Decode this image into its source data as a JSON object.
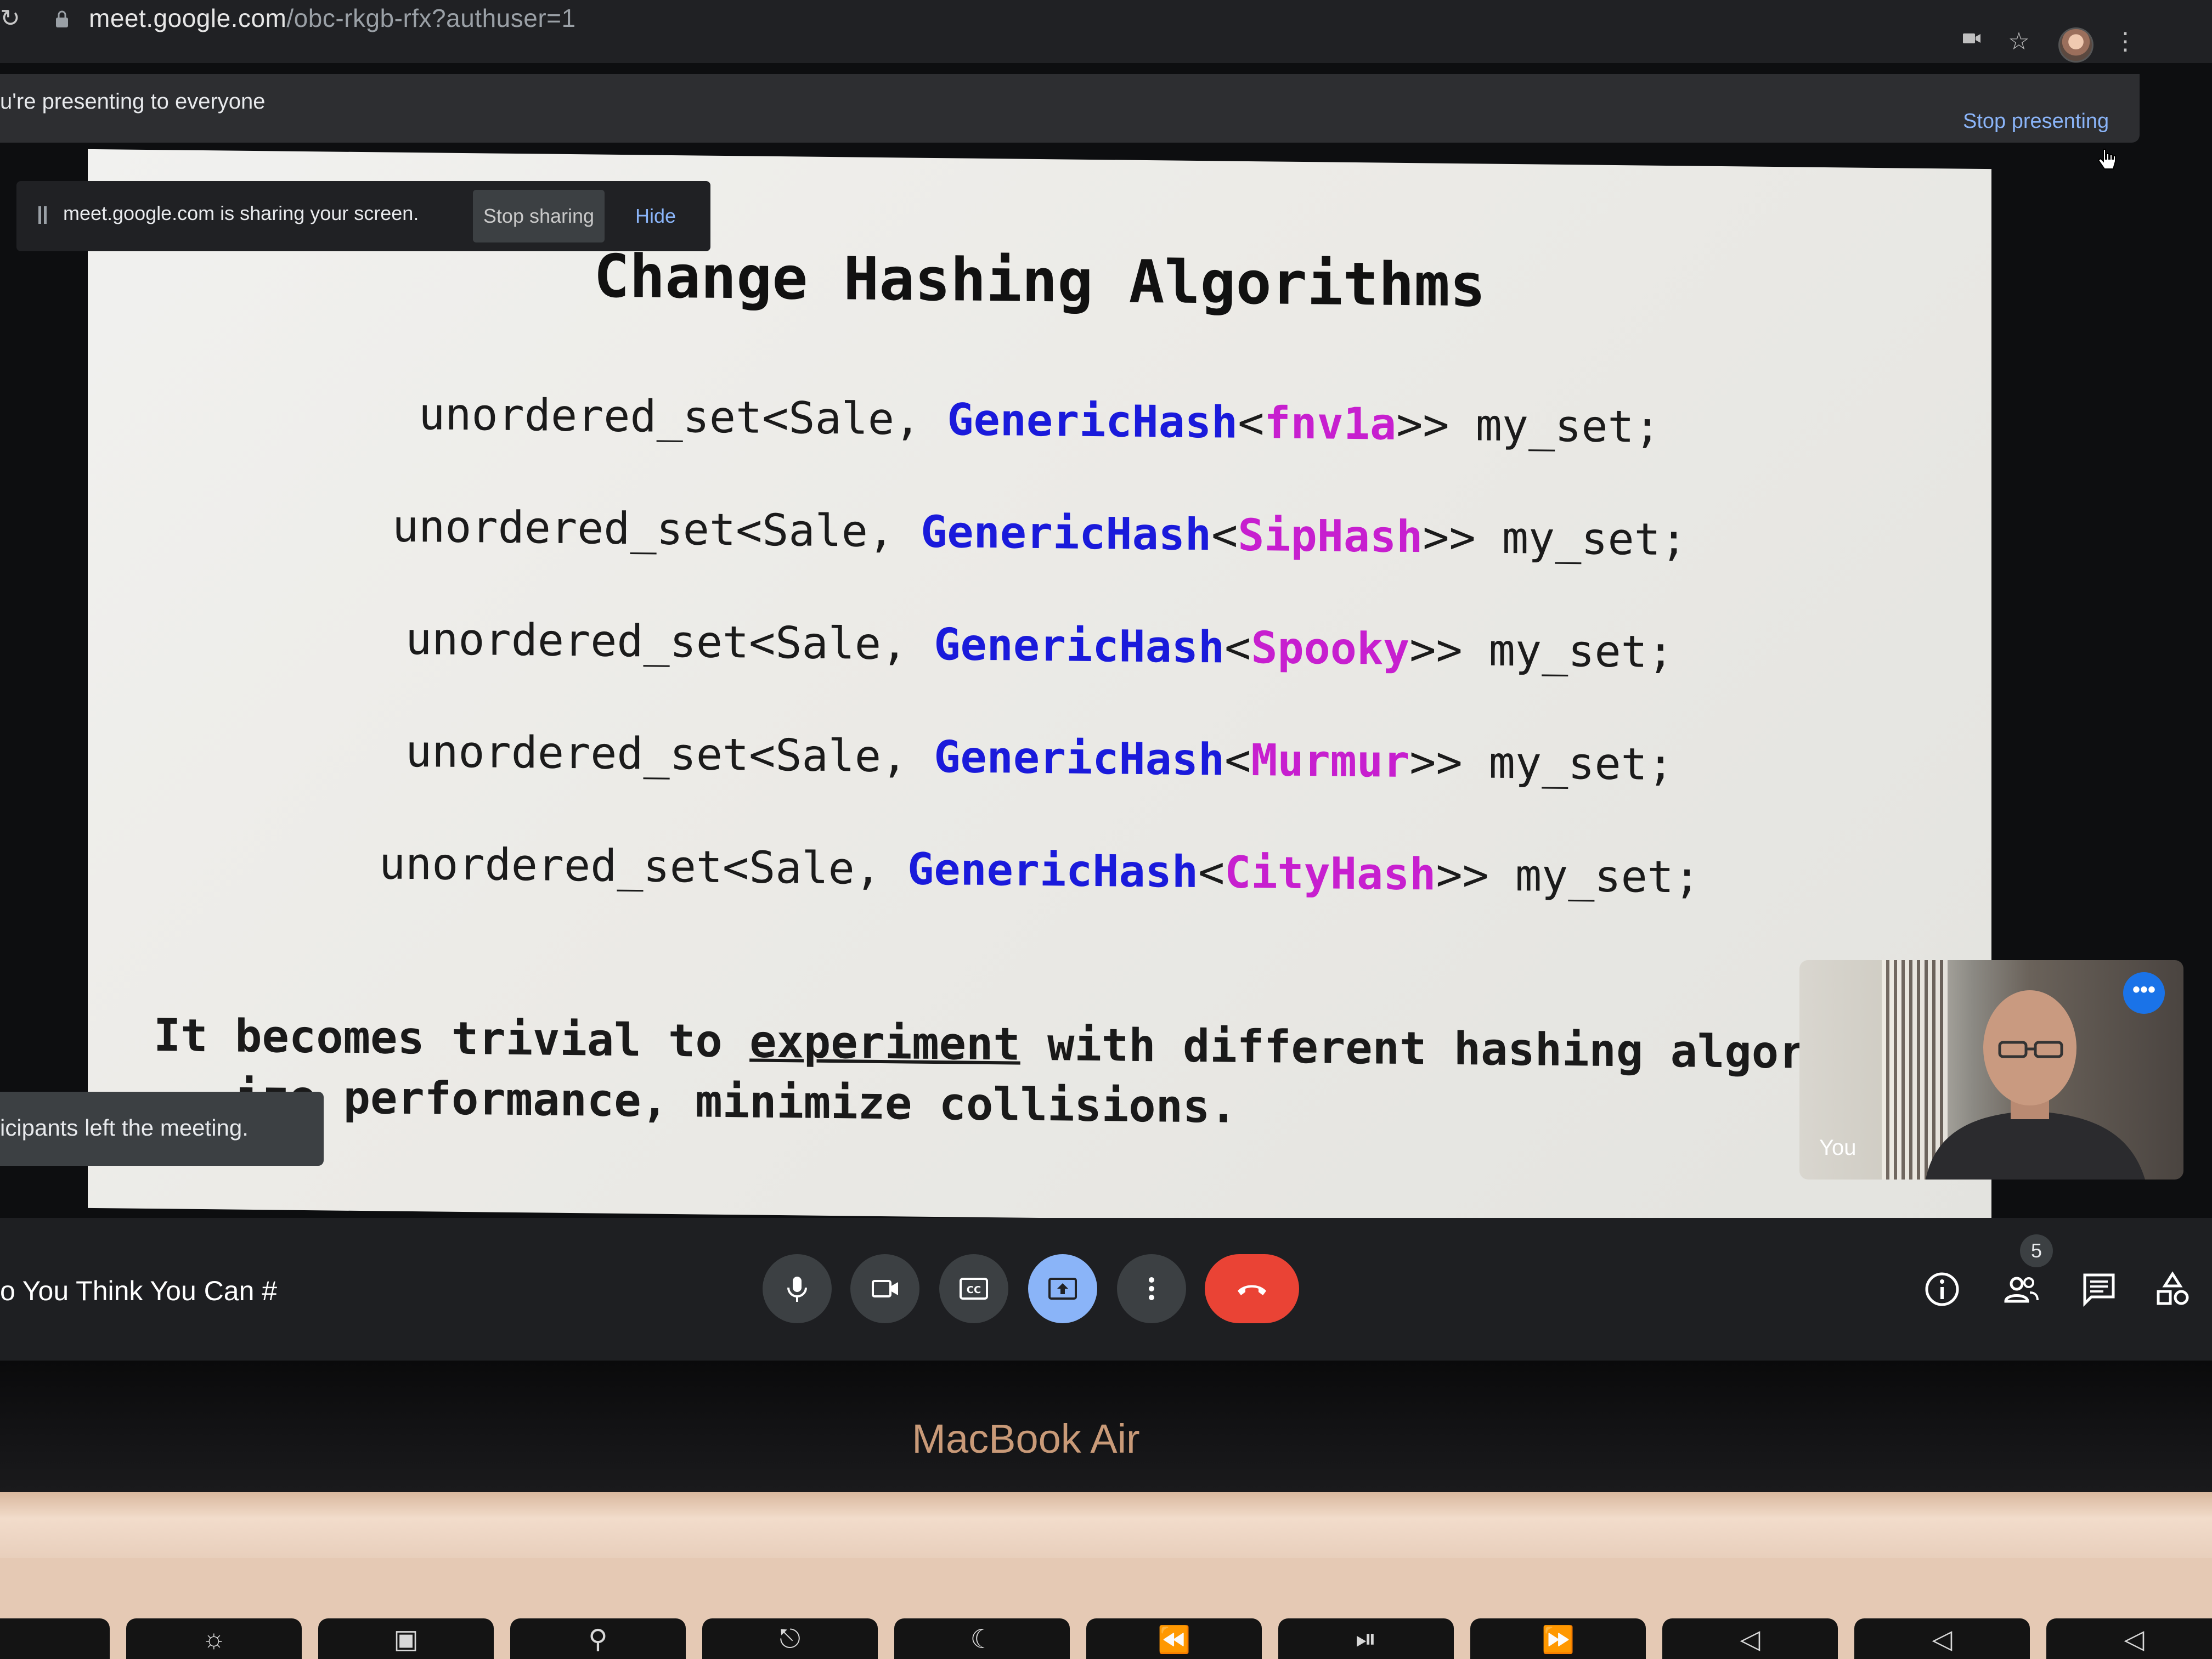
{
  "browser": {
    "url_host": "meet.google.com",
    "url_path": "/obc-rkgb-rfx?authuser=1"
  },
  "presenting_banner": {
    "text": "u're presenting to everyone",
    "stop_label": "Stop presenting"
  },
  "share_bar": {
    "message": "meet.google.com is sharing your screen.",
    "stop_label": "Stop sharing",
    "hide_label": "Hide"
  },
  "slide": {
    "title": "Change Hashing Algorithms",
    "code_lines": [
      {
        "prefix": "unordered_set<Sale, ",
        "type": "GenericHash",
        "open": "<",
        "algo": "fnv1a",
        "suffix": ">> my_set;"
      },
      {
        "prefix": "unordered_set<Sale, ",
        "type": "GenericHash",
        "open": "<",
        "algo": "SipHash",
        "suffix": ">> my_set;"
      },
      {
        "prefix": "unordered_set<Sale, ",
        "type": "GenericHash",
        "open": "<",
        "algo": "Spooky",
        "suffix": ">> my_set;"
      },
      {
        "prefix": "unordered_set<Sale, ",
        "type": "GenericHash",
        "open": "<",
        "algo": "Murmur",
        "suffix": ">> my_set;"
      },
      {
        "prefix": "unordered_set<Sale, ",
        "type": "GenericHash",
        "open": "<",
        "algo": "CityHash",
        "suffix": ">> my_set;"
      }
    ],
    "body_line1_a": "It becomes trivial to ",
    "body_line1_link": "experiment",
    "body_line1_b": " with different hashing algori",
    "body_line2": "   ize performance, minimize collisions."
  },
  "toast": {
    "text": "icipants left the meeting."
  },
  "self_view": {
    "label": "You",
    "more_icon": "more-horiz-icon"
  },
  "call_bar": {
    "meeting_name": "o You Think You Can #",
    "participant_count": "5",
    "controls": [
      "mic-icon",
      "camera-icon",
      "captions-icon",
      "present-icon",
      "more-vert-icon",
      "end-call-icon"
    ],
    "right_icons": [
      "info-icon",
      "people-icon",
      "chat-icon",
      "activities-icon"
    ]
  },
  "device": {
    "label": "MacBook Air"
  },
  "colors": {
    "code_type": "#1a1adb",
    "code_algo": "#c71fcf",
    "link_blue": "#8ab4f8",
    "end_call_red": "#ea4335"
  }
}
